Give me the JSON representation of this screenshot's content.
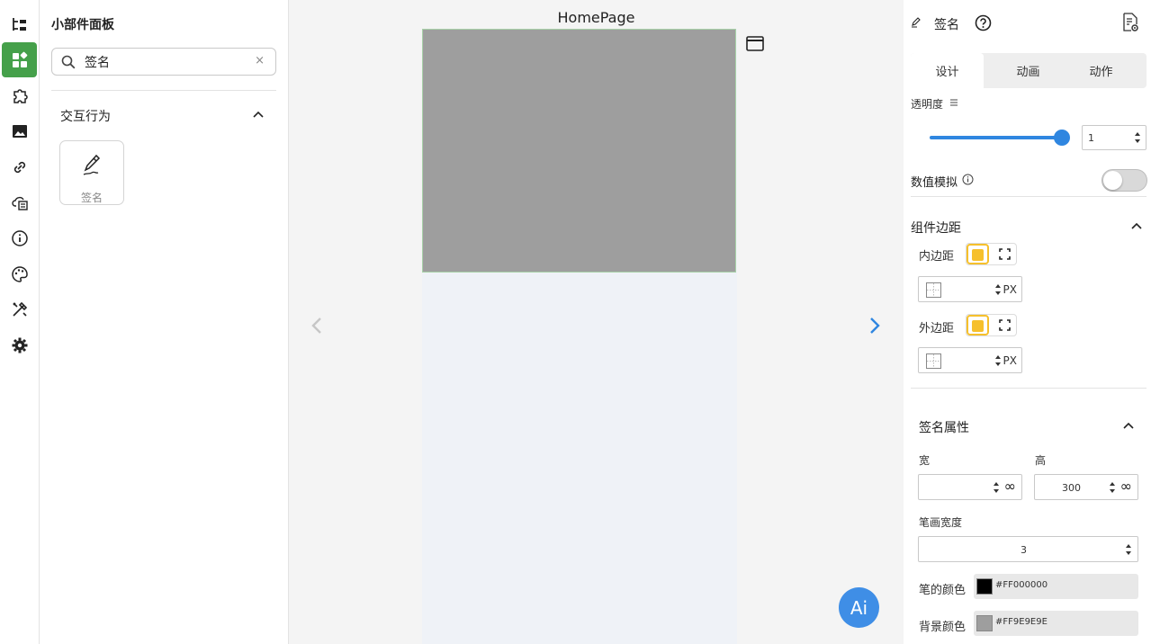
{
  "widget_panel": {
    "title": "小部件面板",
    "search": {
      "value": "签名",
      "clear": "×"
    },
    "section": "交互行为",
    "widgets": [
      {
        "label": "签名"
      }
    ]
  },
  "canvas": {
    "page_name": "HomePage",
    "ai_label": "Ai"
  },
  "props": {
    "title": "签名",
    "tabs": [
      "设计",
      "动画",
      "动作"
    ],
    "active_tab": "设计",
    "opacity_label": "透明度",
    "opacity_value": "1",
    "opacity_level": 1,
    "simulate_label": "数值模拟",
    "simulate_on": false,
    "spacing_title": "组件边距",
    "padding_label": "内边距",
    "margin_label": "外边距",
    "unit_px": "PX",
    "sig_props_title": "签名属性",
    "width_label": "宽",
    "height_label": "高",
    "width_value": "",
    "height_value": "300",
    "stroke_label": "笔画宽度",
    "stroke_value": "3",
    "pen_color_label": "笔的颜色",
    "pen_color": "#FF000000",
    "bg_color_label": "背景颜色",
    "bg_color": "#FF9E9E9E",
    "inf_symbol": "∞"
  },
  "colors": {
    "accent_green": "#45a04a",
    "accent_blue": "#2f86e0",
    "toggle_highlight": "#f6c02c",
    "signature_bg": "#9e9e9e",
    "pen_swatch": "#000000"
  },
  "icons": {
    "rail": [
      "tree-icon",
      "widgets-icon",
      "puzzle-icon",
      "image-icon",
      "link-icon",
      "cloud-data-icon",
      "info-icon",
      "palette-icon",
      "tools-icon",
      "settings-icon"
    ]
  }
}
